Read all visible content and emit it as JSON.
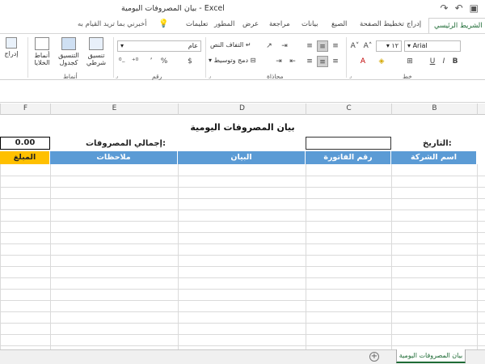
{
  "window": {
    "title": "بيان المصروفات اليومية  -  Excel"
  },
  "ribbon_tabs": {
    "home": "الشريط الرئيسي",
    "insert": "إدراج",
    "page_layout": "تخطيط الصفحة",
    "formulas": "الصيغ",
    "data": "بيانات",
    "review": "مراجعة",
    "view": "عرض",
    "developer": "المطور",
    "help": "تعليمات",
    "tell_me": "أخبرني بما تريد القيام به"
  },
  "ribbon": {
    "font_name": "Arial",
    "font_size": "١٢",
    "number_format": "عام",
    "wrap_text": "التفاف النص",
    "merge_center": "دمج وتوسيط",
    "conditional_formatting": "تنسيق شرطي",
    "format_as_table": "التنسيق كجدول",
    "cell_styles": "أنماط الخلايا",
    "insert": "إدراج",
    "group_font": "خط",
    "group_alignment": "محاذاة",
    "group_number": "رقم",
    "group_styles": "أنماط",
    "percent_symbol": "%",
    "currency_symbol": "$",
    "comma_symbol": "٬"
  },
  "columns": {
    "b": "B",
    "c": "C",
    "d": "D",
    "e": "E",
    "f": "F"
  },
  "sheet": {
    "title": "بيان المصروفات اليومية",
    "date_label": "التاريخ:",
    "total_label": "إجمالي المصروفات:",
    "total_value": "0.00",
    "headers": {
      "company_name": "اسم الشركة",
      "invoice_number": "رقم الفاتورة",
      "description": "البيان",
      "notes": "ملاحظات",
      "amount": "المبلغ"
    }
  },
  "sheet_tabs": {
    "active": "بيان المصروفات اليومية"
  },
  "colors": {
    "header_blue": "#5b9bd5",
    "amount_gold": "#ffc000",
    "excel_green": "#1e6b35"
  }
}
